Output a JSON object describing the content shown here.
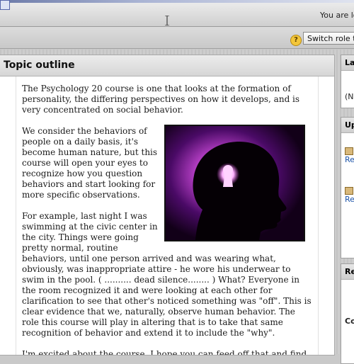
{
  "header": {
    "login_info": "You are logged in as"
  },
  "navbar": {
    "help_glyph": "?",
    "switch_role_label": "Switch role to..."
  },
  "main": {
    "title": "Topic outline",
    "paragraphs": [
      "The Psychology 20 course is one that looks at the formation of personality, the differing perspectives on how it develops, and is very concentrated on social behavior.",
      "We consider the behaviors of people on a daily basis, it's become human nature, but this course will open your eyes to recognize how you question behaviors and start looking for more specific observations.",
      "For example, last night I was swimming at the civic center in the city. Things were going pretty normal, routine behaviors, until one person arrived and was wearing what, obviously, was inappropriate attire - he wore his underwear to swim in the pool. ( .......... dead silence........ ) What? Everyone in the room recognized it and were looking at each other for clarification to see that other's noticed something was \"off\". This is clear evidence that we, naturally, observe human behavior. The role this course will play in altering that is to take that same recognition of behavior and extend it to include the \"why\".",
      "I'm excited about the course. I hope you can feed off that and find some"
    ],
    "image_icon": "head-silhouette-keyhole-image"
  },
  "sidebar": {
    "block1": {
      "head": "La",
      "line": "(N"
    },
    "block2": {
      "head": "Up",
      "link1": "Re",
      "link2": "Re"
    },
    "block3": {
      "head": "Re",
      "line": "Co"
    }
  }
}
